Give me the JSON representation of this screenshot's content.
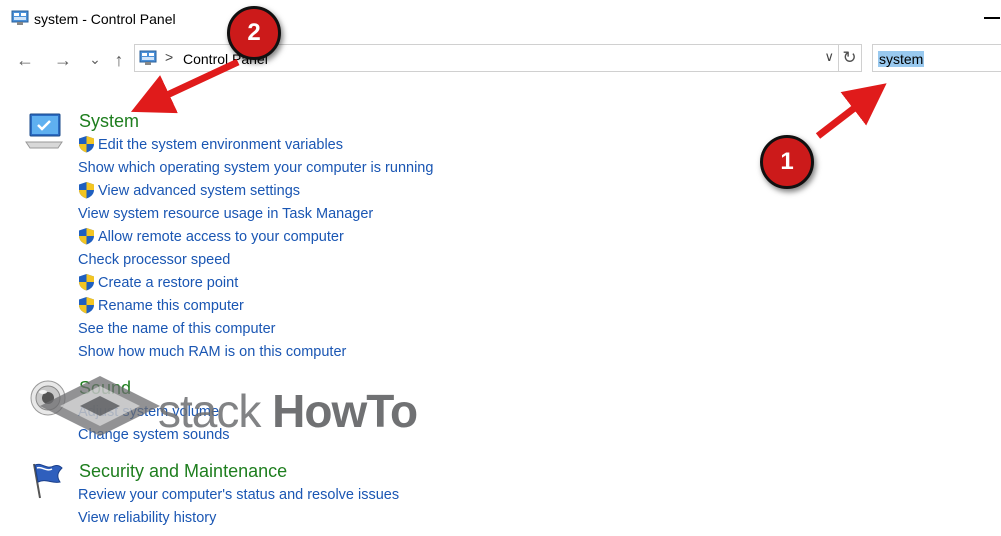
{
  "window": {
    "title": "system - Control Panel"
  },
  "nav": {
    "back": "←",
    "forward": "→",
    "recent": "⌄",
    "up": "↑"
  },
  "address": {
    "separator": ">",
    "path": "Control Panel",
    "dropdown": "∨"
  },
  "refresh": "↻",
  "search": {
    "value": "system"
  },
  "sections": {
    "system": {
      "title": "System",
      "links": [
        "Edit the system environment variables",
        "Show which operating system your computer is running",
        "View advanced system settings",
        "View system resource usage in Task Manager",
        "Allow remote access to your computer",
        "Check processor speed",
        "Create a restore point",
        "Rename this computer",
        "See the name of this computer",
        "Show how much RAM is on this computer"
      ]
    },
    "sound": {
      "title": "Sound",
      "links": [
        "Adjust system volume",
        "Change system sounds"
      ]
    },
    "security": {
      "title": "Security and Maintenance",
      "links": [
        "Review your computer's status and resolve issues",
        "View reliability history"
      ]
    }
  },
  "watermark": {
    "part1": "stack ",
    "part2": "HowTo"
  },
  "callouts": {
    "one": "1",
    "two": "2"
  },
  "colors": {
    "category": "#1e7e1e",
    "link": "#1a56b3",
    "callout": "#cc1a1a",
    "selection": "#99c9ef"
  }
}
